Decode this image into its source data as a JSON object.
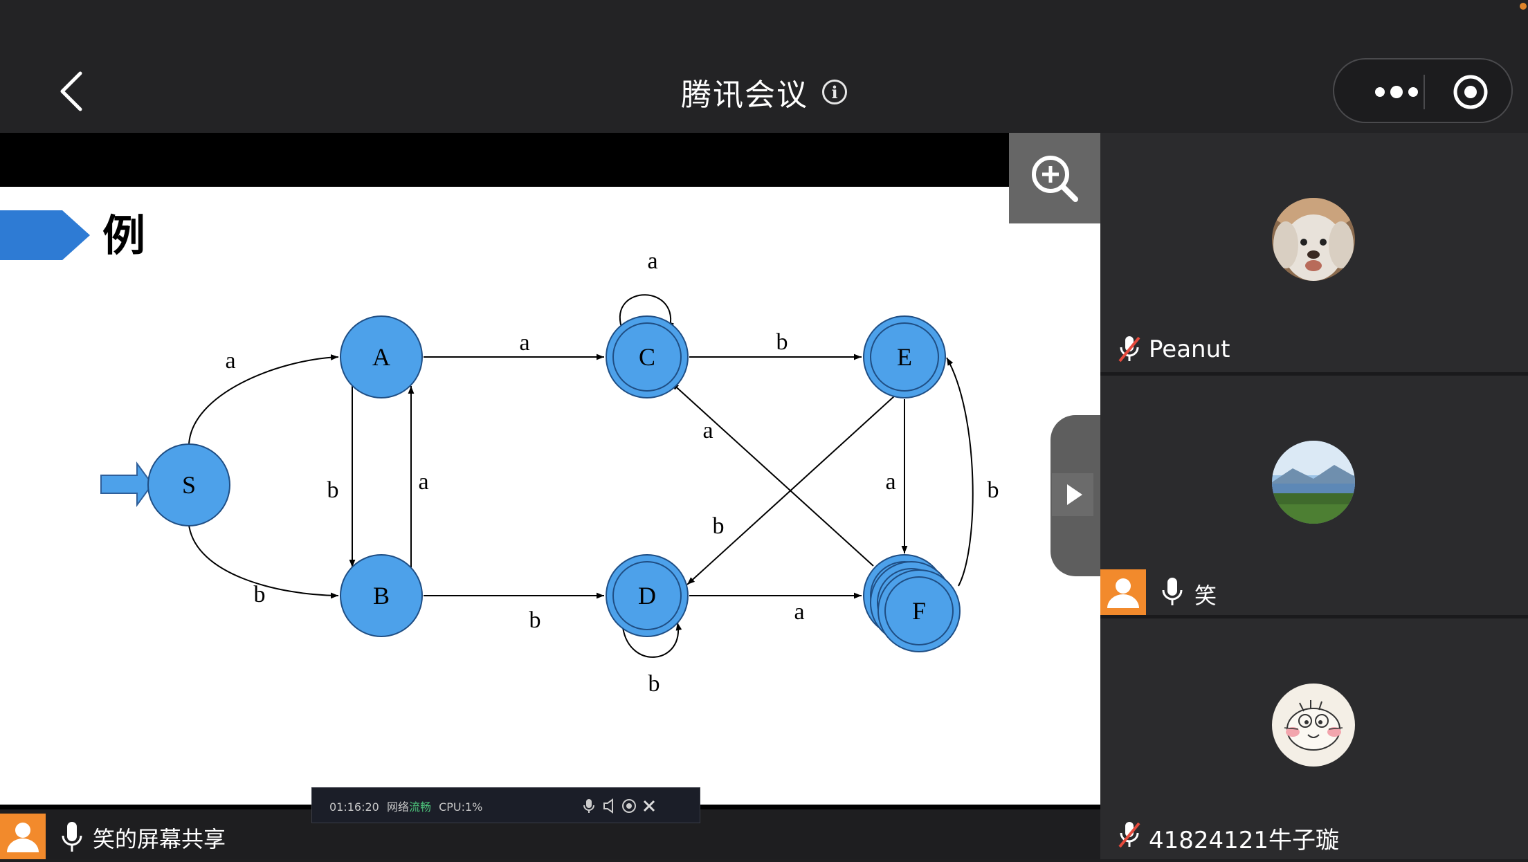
{
  "topbar": {
    "title": "腾讯会议"
  },
  "icons": {
    "back": "back-arrow-icon",
    "info": "info-icon",
    "more": "more-dots-icon",
    "record": "record-icon",
    "zoom": "zoom-in-icon",
    "play": "play-triangle-icon"
  },
  "slide": {
    "heading": "例",
    "states": [
      {
        "id": "S",
        "label": "S",
        "accepting": false,
        "start": true
      },
      {
        "id": "A",
        "label": "A",
        "accepting": false
      },
      {
        "id": "B",
        "label": "B",
        "accepting": false
      },
      {
        "id": "C",
        "label": "C",
        "accepting": true
      },
      {
        "id": "D",
        "label": "D",
        "accepting": true
      },
      {
        "id": "E",
        "label": "E",
        "accepting": true
      },
      {
        "id": "F",
        "label": "F",
        "accepting": true
      }
    ],
    "transitions": [
      {
        "from": "S",
        "to": "A",
        "label": "a"
      },
      {
        "from": "S",
        "to": "B",
        "label": "b"
      },
      {
        "from": "A",
        "to": "C",
        "label": "a"
      },
      {
        "from": "A",
        "to": "B",
        "label": "b"
      },
      {
        "from": "B",
        "to": "A",
        "label": "a"
      },
      {
        "from": "B",
        "to": "D",
        "label": "b"
      },
      {
        "from": "C",
        "to": "C",
        "label": "a"
      },
      {
        "from": "C",
        "to": "E",
        "label": "b"
      },
      {
        "from": "D",
        "to": "D",
        "label": "b"
      },
      {
        "from": "D",
        "to": "F",
        "label": "a"
      },
      {
        "from": "E",
        "to": "D",
        "label": "b"
      },
      {
        "from": "E",
        "to": "F",
        "label": "a"
      },
      {
        "from": "F",
        "to": "C",
        "label": "a"
      },
      {
        "from": "F",
        "to": "E",
        "label": "b"
      }
    ]
  },
  "participants": [
    {
      "name": "Peanut",
      "mic": "muted",
      "avatar": "dog-photo-avatar"
    },
    {
      "name": "笑",
      "mic": "on",
      "avatar": "landscape-photo-avatar"
    },
    {
      "name": "41824121牛子璇",
      "mic": "muted",
      "avatar": "cartoon-cat-avatar"
    }
  ],
  "share": {
    "label": "笑的屏幕共享"
  },
  "float_toolbar": {
    "time": "01:16:20",
    "network_label": "网络",
    "network_status": "流畅",
    "cpu": "CPU:1%"
  },
  "colors": {
    "state_fill": "#4da1ea",
    "accent_orange": "#f28a2c",
    "heading_bar": "#2e7bd4",
    "muted_red": "#e64a3c"
  }
}
